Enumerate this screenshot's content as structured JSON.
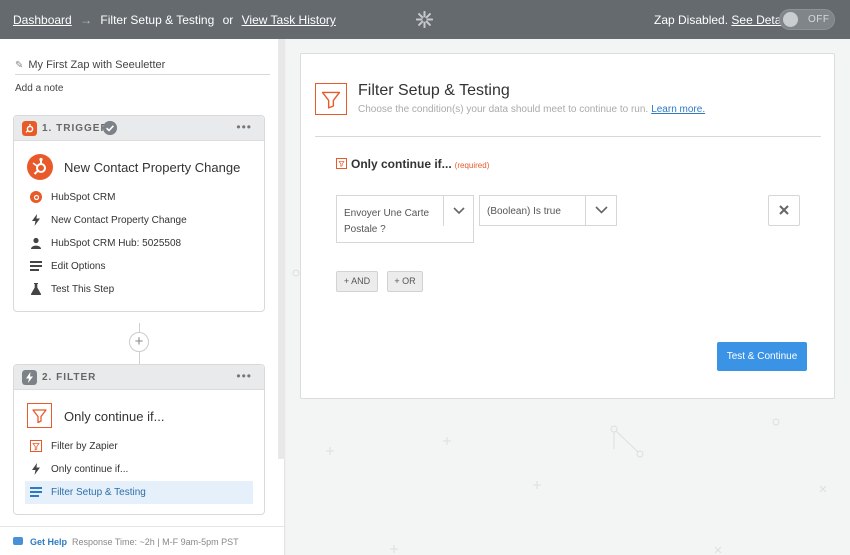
{
  "topbar": {
    "dashboard": "Dashboard",
    "arrow": "→",
    "current": "Filter Setup & Testing",
    "or": "or",
    "history": "View Task History",
    "status": "Zap Disabled.",
    "see_details": "See Details",
    "toggle_label": "OFF"
  },
  "left": {
    "zap_name": "My First Zap with Seeuletter",
    "add_note": "Add a note",
    "trigger": {
      "step_label": "1. TRIGGER",
      "title": "New Contact Property Change",
      "rows": [
        {
          "icon": "hubspot-icon",
          "label": "HubSpot CRM"
        },
        {
          "icon": "bolt-icon",
          "label": "New Contact Property Change"
        },
        {
          "icon": "user-icon",
          "label": "HubSpot CRM Hub: 5025508"
        },
        {
          "icon": "list-icon",
          "label": "Edit Options"
        },
        {
          "icon": "flask-icon",
          "label": "Test This Step"
        }
      ]
    },
    "filter": {
      "step_label": "2. FILTER",
      "title": "Only continue if...",
      "rows": [
        {
          "icon": "filter-icon",
          "label": "Filter by Zapier"
        },
        {
          "icon": "bolt-icon",
          "label": "Only continue if..."
        },
        {
          "icon": "list-icon",
          "label": "Filter Setup & Testing",
          "active": true
        }
      ]
    },
    "help": {
      "label": "Get Help",
      "response": "Response Time: ~2h | M-F 9am-5pm PST"
    }
  },
  "panel": {
    "title": "Filter Setup & Testing",
    "subtitle": "Choose the condition(s) your data should meet to continue to run.",
    "learn_more": "Learn more.",
    "section_label": "Only continue if...",
    "required": "(required)",
    "field_value": "Envoyer Une Carte Postale ?",
    "condition_value": "(Boolean) Is true",
    "and_button": "+ AND",
    "or_button": "+ OR",
    "cta": "Test & Continue"
  },
  "colors": {
    "brand_orange": "#e85a2a",
    "primary_blue": "#3b93e6",
    "topbar": "#646a6e"
  }
}
